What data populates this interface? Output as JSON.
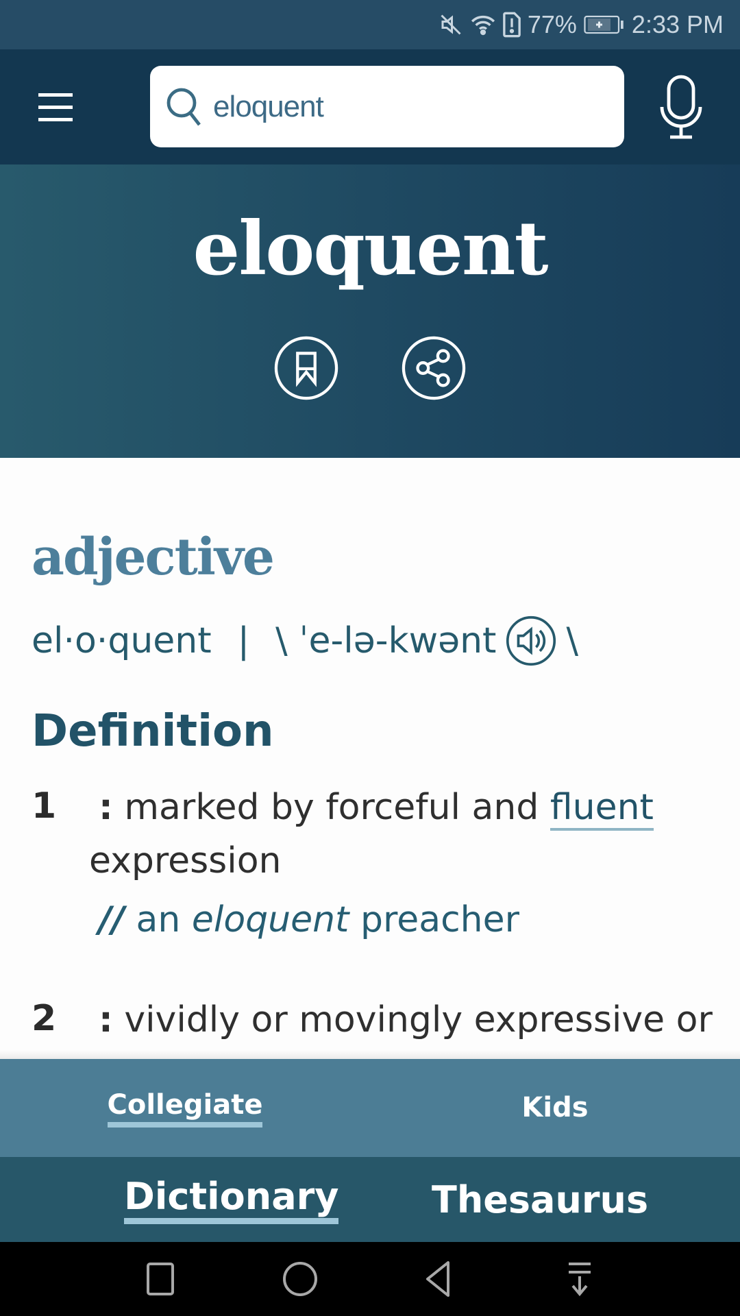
{
  "status_bar": {
    "icons": [
      "mute-icon",
      "wifi-icon",
      "sim-alert-icon",
      "battery-charging-icon"
    ],
    "battery_percent": "77%",
    "time": "2:33 PM"
  },
  "app_bar": {
    "menu_icon": "hamburger-menu-icon",
    "search": {
      "value": "eloquent",
      "icon": "search-icon"
    },
    "voice_icon": "microphone-icon"
  },
  "entry": {
    "headword": "eloquent",
    "actions": [
      {
        "name": "bookmark",
        "icon": "bookmark-icon"
      },
      {
        "name": "share",
        "icon": "share-icon"
      }
    ],
    "part_of_speech": "adjective",
    "syllables": "el·o·quent",
    "separator": "|",
    "pronunciation_open": "\\ ˈe-lə-kwənt",
    "pronunciation_close": "\\",
    "audio_icon": "speaker-icon"
  },
  "definition": {
    "heading": "Definition",
    "senses": [
      {
        "number": "1",
        "colon": ":",
        "text_before_link": " marked by forceful and ",
        "link": "fluent",
        "text_after_link": " expression",
        "example": {
          "marker": "//",
          "before": " an ",
          "italic": "eloquent",
          "after": " preacher"
        }
      },
      {
        "number": "2",
        "colon": ":",
        "text": " vividly or movingly expressive or"
      }
    ]
  },
  "sub_tabs": [
    {
      "label": "Collegiate",
      "active": true
    },
    {
      "label": "Kids",
      "active": false
    }
  ],
  "main_tabs": [
    {
      "label": "Dictionary",
      "active": true
    },
    {
      "label": "Thesaurus",
      "active": false
    }
  ],
  "nav_bar": [
    "recents-square-icon",
    "home-circle-icon",
    "back-triangle-icon",
    "notifications-pull-down-icon"
  ],
  "colors": {
    "status_bar": "#264c66",
    "app_bar": "#133750",
    "hero_start": "#285a6c",
    "hero_end": "#173c58",
    "part_of_speech": "#4d7f9b",
    "accent_text": "#225368",
    "sub_tabs_bg": "#4c7d95",
    "main_tabs_bg": "#275769",
    "active_underline": "#9ec6d8"
  }
}
